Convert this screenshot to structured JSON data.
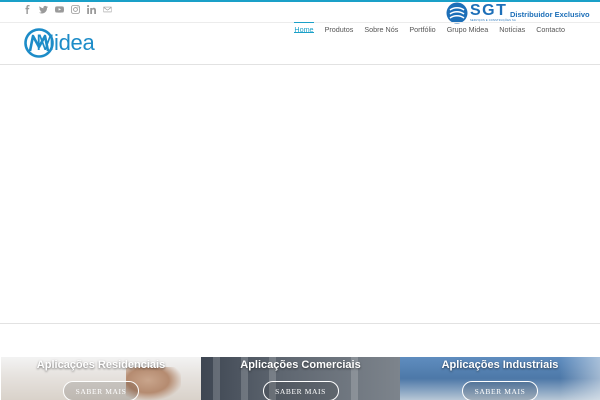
{
  "topbar": {
    "social_icons": [
      "facebook-icon",
      "twitter-icon",
      "youtube-icon",
      "instagram-icon",
      "linkedin-icon",
      "email-icon"
    ],
    "partner": {
      "name": "SGT",
      "subtitle": "SERVIÇOS E CONSTRUÇÕES SA",
      "tagline": "Distribuidor Exclusivo"
    }
  },
  "header": {
    "logo_text": "Midea",
    "nav": [
      {
        "label": "Home",
        "active": true
      },
      {
        "label": "Produtos",
        "active": false
      },
      {
        "label": "Sobre Nós",
        "active": false
      },
      {
        "label": "Portfólio",
        "active": false
      },
      {
        "label": "Grupo Midea",
        "active": false
      },
      {
        "label": "Notícias",
        "active": false
      },
      {
        "label": "Contacto",
        "active": false
      }
    ]
  },
  "cards": [
    {
      "title": "Aplicações Residenciais",
      "button": "SABER MAIS"
    },
    {
      "title": "Aplicações Comerciais",
      "button": "SABER MAIS"
    },
    {
      "title": "Aplicações Industriais",
      "button": "SABER MAIS"
    }
  ],
  "colors": {
    "accent": "#1aa0c8",
    "brand_blue": "#1d6fb8",
    "nav_text": "#555555"
  }
}
